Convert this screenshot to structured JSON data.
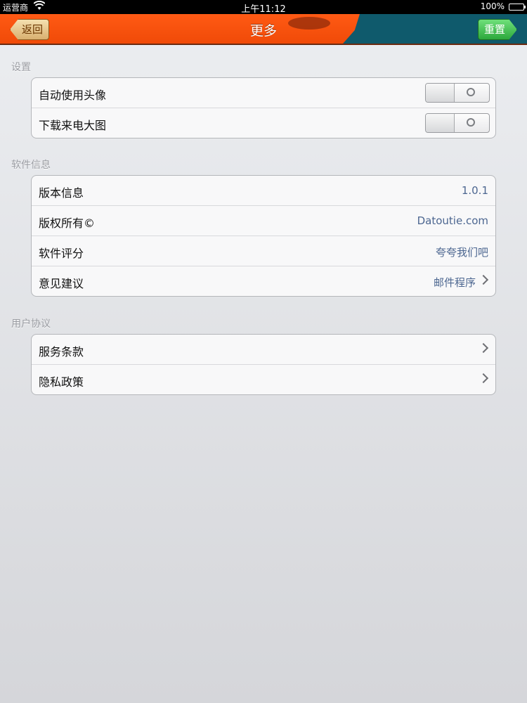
{
  "status_bar": {
    "carrier": "运营商",
    "time": "上午11:12",
    "battery": "100%"
  },
  "nav": {
    "title": "更多",
    "back_label": "返回",
    "reset_label": "重置"
  },
  "sections": [
    {
      "header": "设置",
      "rows": [
        {
          "label": "自动使用头像",
          "toggle": "off"
        },
        {
          "label": "下载来电大图",
          "toggle": "off"
        }
      ]
    },
    {
      "header": "软件信息",
      "rows": [
        {
          "label": "版本信息",
          "value": "1.0.1"
        },
        {
          "label": "版权所有©",
          "value": "Datoutie.com"
        },
        {
          "label": "软件评分",
          "value": "夸夸我们吧"
        },
        {
          "label": "意见建议",
          "value": "邮件程序",
          "chevron": true
        }
      ]
    },
    {
      "header": "用户协议",
      "rows": [
        {
          "label": "服务条款",
          "chevron": true
        },
        {
          "label": "隐私政策",
          "chevron": true
        }
      ]
    }
  ],
  "colors": {
    "nav_orange": "#f04a08",
    "nav_teal": "#0f5a6c",
    "value_text": "#4c6690",
    "reset_green": "#2ca83c"
  }
}
